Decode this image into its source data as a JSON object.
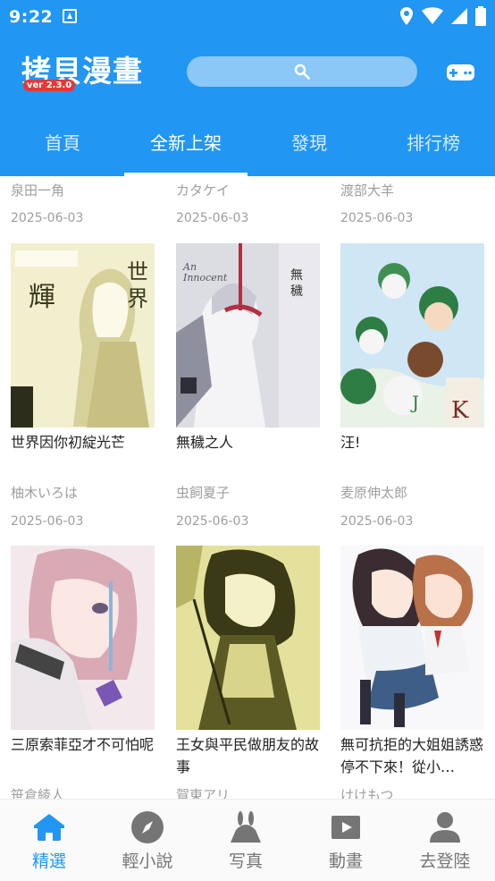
{
  "status_bar": {
    "time": "9:22",
    "icons": [
      "notification-icon",
      "location-icon",
      "wifi-icon",
      "signal-icon",
      "battery-icon"
    ]
  },
  "header": {
    "logo_text": "拷貝漫畫",
    "version": "ver 2.3.0",
    "search_placeholder": "",
    "accent_color": "#2196f3"
  },
  "tabs": [
    {
      "label": "首頁",
      "active": false
    },
    {
      "label": "全新上架",
      "active": true
    },
    {
      "label": "發現",
      "active": false
    },
    {
      "label": "排行榜",
      "active": false
    }
  ],
  "partial_row": [
    {
      "author": "泉田一角",
      "date": "2025-06-03"
    },
    {
      "author": "カタケイ",
      "date": "2025-06-03"
    },
    {
      "author": "渡部大羊",
      "date": "2025-06-03"
    }
  ],
  "row1": [
    {
      "title": "世界因你初綻光芒",
      "author": "柚木いろは",
      "date": "2025-06-03"
    },
    {
      "title": "無穢之人",
      "author": "虫飼夏子",
      "date": "2025-06-03"
    },
    {
      "title": "汪!",
      "author": "麦原伸太郎",
      "date": "2025-06-03"
    }
  ],
  "row2": [
    {
      "title": "三原索菲亞才不可怕呢",
      "author": "笹倉綾人"
    },
    {
      "title": "王女與平民做朋友的故事",
      "author": "賀東アリ"
    },
    {
      "title": "無可抗拒的大姐姐誘惑停不下來！從小…",
      "author": "けけもつ"
    }
  ],
  "bottom_nav": [
    {
      "label": "精選",
      "icon": "home-icon",
      "active": true
    },
    {
      "label": "輕小說",
      "icon": "compass-icon",
      "active": false
    },
    {
      "label": "写真",
      "icon": "rabbit-icon",
      "active": false
    },
    {
      "label": "動畫",
      "icon": "play-icon",
      "active": false
    },
    {
      "label": "去登陸",
      "icon": "person-icon",
      "active": false
    }
  ]
}
